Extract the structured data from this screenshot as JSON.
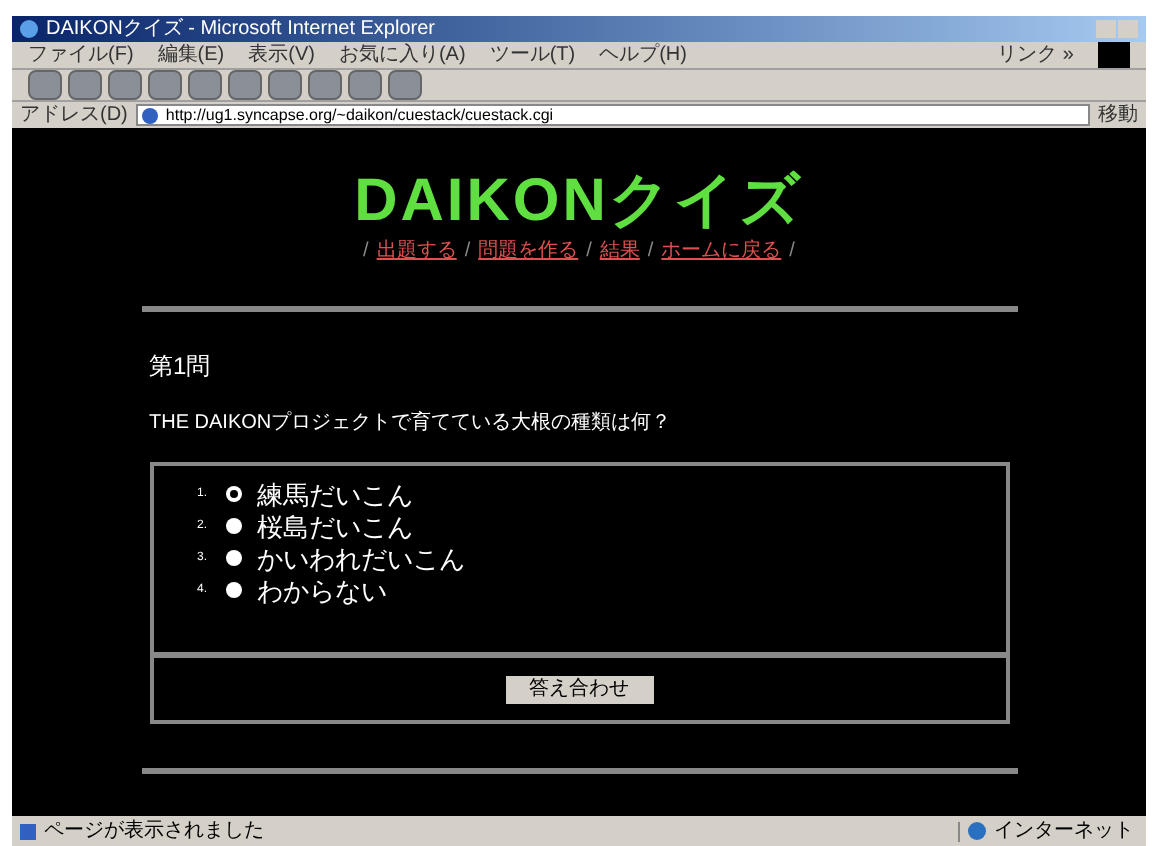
{
  "window": {
    "title": "DAIKONクイズ - Microsoft Internet Explorer"
  },
  "menu": [
    "ファイル(F)",
    "編集(E)",
    "表示(V)",
    "お気に入り(A)",
    "ツール(T)",
    "ヘルプ(H)"
  ],
  "menu_right": "リンク »",
  "address": {
    "label": "アドレス(D)",
    "value": "http://ug1.syncapse.org/~daikon/cuestack/cuestack.cgi",
    "go": "移動"
  },
  "page": {
    "logo": "DAIKONクイズ",
    "nav": [
      "出題する",
      "問題を作る",
      "結果",
      "ホームに戻る"
    ],
    "nav_separator": "/",
    "heading": "第1問",
    "question": "THE DAIKONプロジェクトで育てている大根の種類は何？",
    "options": [
      {
        "number": "1.",
        "label": "練馬だいこん",
        "selected": true
      },
      {
        "number": "2.",
        "label": "桜島だいこん",
        "selected": false
      },
      {
        "number": "3.",
        "label": "かいわれだいこん",
        "selected": false
      },
      {
        "number": "4.",
        "label": "わからない",
        "selected": false
      }
    ],
    "submit": "答え合わせ"
  },
  "status_bar": {
    "text": "ページが表示されました",
    "zone": "インターネット"
  }
}
